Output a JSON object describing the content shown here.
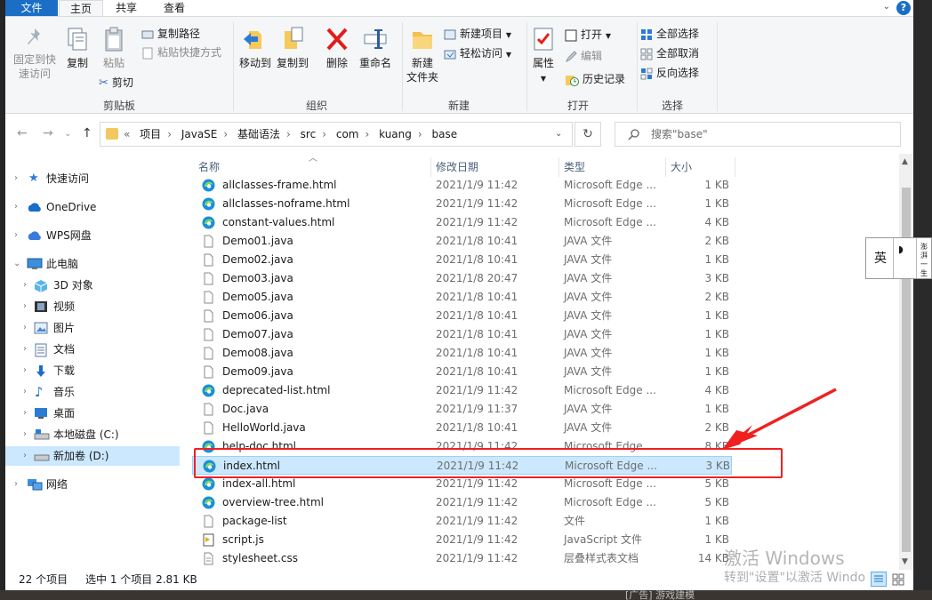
{
  "tabs": [
    {
      "label": "文件"
    },
    {
      "label": "主页"
    },
    {
      "label": "共享"
    },
    {
      "label": "查看"
    }
  ],
  "ribbon": {
    "clipboard": {
      "group_label": "剪贴板",
      "pin_label_1": "固定到快",
      "pin_label_2": "速访问",
      "copy_label": "复制",
      "paste_label": "粘贴",
      "copy_path_label": "复制路径",
      "paste_shortcut_label": "粘贴快捷方式",
      "cut_label": "剪切"
    },
    "organize": {
      "group_label": "组织",
      "move_to_label": "移动到",
      "copy_to_label": "复制到",
      "delete_label": "删除",
      "rename_label": "重命名"
    },
    "new": {
      "group_label": "新建",
      "new_folder_label_1": "新建",
      "new_folder_label_2": "文件夹",
      "new_item_label": "新建项目",
      "easy_access_label": "轻松访问"
    },
    "open": {
      "group_label": "打开",
      "properties_label": "属性",
      "open_label": "打开",
      "edit_label": "编辑",
      "history_label": "历史记录"
    },
    "select": {
      "group_label": "选择",
      "select_all_label": "全部选择",
      "select_none_label": "全部取消",
      "invert_label": "反向选择"
    }
  },
  "address": {
    "overflow": "«",
    "crumbs": [
      "项目",
      "JavaSE",
      "基础语法",
      "src",
      "com",
      "kuang",
      "base"
    ],
    "separator": "›"
  },
  "search": {
    "placeholder": "搜索\"base\""
  },
  "navpane": {
    "items": [
      {
        "label": "快速访问",
        "icon": "star-icon"
      },
      {
        "label": "OneDrive",
        "icon": "cloud-icon"
      },
      {
        "label": "WPS网盘",
        "icon": "cloud-icon"
      },
      {
        "label": "此电脑",
        "icon": "computer-icon"
      },
      {
        "label": "3D 对象",
        "icon": "cube-icon"
      },
      {
        "label": "视频",
        "icon": "film-icon"
      },
      {
        "label": "图片",
        "icon": "picture-icon"
      },
      {
        "label": "文档",
        "icon": "document-icon"
      },
      {
        "label": "下载",
        "icon": "download-icon"
      },
      {
        "label": "音乐",
        "icon": "music-icon"
      },
      {
        "label": "桌面",
        "icon": "desktop-icon"
      },
      {
        "label": "本地磁盘 (C:)",
        "icon": "drive-icon"
      },
      {
        "label": "新加卷 (D:)",
        "icon": "drive-icon"
      },
      {
        "label": "网络",
        "icon": "network-icon"
      }
    ]
  },
  "columns": {
    "name": "名称",
    "date": "修改日期",
    "type": "类型",
    "size": "大小"
  },
  "files": [
    {
      "name": "allclasses-frame.html",
      "date": "2021/1/9 11:42",
      "type": "Microsoft Edge ...",
      "size": "1 KB",
      "icon": "edge"
    },
    {
      "name": "allclasses-noframe.html",
      "date": "2021/1/9 11:42",
      "type": "Microsoft Edge ...",
      "size": "1 KB",
      "icon": "edge"
    },
    {
      "name": "constant-values.html",
      "date": "2021/1/9 11:42",
      "type": "Microsoft Edge ...",
      "size": "4 KB",
      "icon": "edge"
    },
    {
      "name": "Demo01.java",
      "date": "2021/1/8 10:41",
      "type": "JAVA 文件",
      "size": "2 KB",
      "icon": "file"
    },
    {
      "name": "Demo02.java",
      "date": "2021/1/8 10:41",
      "type": "JAVA 文件",
      "size": "1 KB",
      "icon": "file"
    },
    {
      "name": "Demo03.java",
      "date": "2021/1/8 20:47",
      "type": "JAVA 文件",
      "size": "3 KB",
      "icon": "file"
    },
    {
      "name": "Demo05.java",
      "date": "2021/1/8 10:41",
      "type": "JAVA 文件",
      "size": "2 KB",
      "icon": "file"
    },
    {
      "name": "Demo06.java",
      "date": "2021/1/8 10:41",
      "type": "JAVA 文件",
      "size": "1 KB",
      "icon": "file"
    },
    {
      "name": "Demo07.java",
      "date": "2021/1/8 10:41",
      "type": "JAVA 文件",
      "size": "1 KB",
      "icon": "file"
    },
    {
      "name": "Demo08.java",
      "date": "2021/1/8 10:41",
      "type": "JAVA 文件",
      "size": "1 KB",
      "icon": "file"
    },
    {
      "name": "Demo09.java",
      "date": "2021/1/8 10:41",
      "type": "JAVA 文件",
      "size": "1 KB",
      "icon": "file"
    },
    {
      "name": "deprecated-list.html",
      "date": "2021/1/9 11:42",
      "type": "Microsoft Edge ...",
      "size": "4 KB",
      "icon": "edge"
    },
    {
      "name": "Doc.java",
      "date": "2021/1/9 11:37",
      "type": "JAVA 文件",
      "size": "1 KB",
      "icon": "file"
    },
    {
      "name": "HelloWorld.java",
      "date": "2021/1/8 10:41",
      "type": "JAVA 文件",
      "size": "2 KB",
      "icon": "file"
    },
    {
      "name": "help-doc.html",
      "date": "2021/1/9 11:42",
      "type": "Microsoft Edge ...",
      "size": "8 KB",
      "icon": "edge"
    },
    {
      "name": "index.html",
      "date": "2021/1/9 11:42",
      "type": "Microsoft Edge ...",
      "size": "3 KB",
      "icon": "edge",
      "selected": true
    },
    {
      "name": "index-all.html",
      "date": "2021/1/9 11:42",
      "type": "Microsoft Edge ...",
      "size": "5 KB",
      "icon": "edge"
    },
    {
      "name": "overview-tree.html",
      "date": "2021/1/9 11:42",
      "type": "Microsoft Edge ...",
      "size": "5 KB",
      "icon": "edge"
    },
    {
      "name": "package-list",
      "date": "2021/1/9 11:42",
      "type": "文件",
      "size": "1 KB",
      "icon": "file"
    },
    {
      "name": "script.js",
      "date": "2021/1/9 11:42",
      "type": "JavaScript 文件",
      "size": "1 KB",
      "icon": "js"
    },
    {
      "name": "stylesheet.css",
      "date": "2021/1/9 11:42",
      "type": "层叠样式表文档",
      "size": "14 KB",
      "icon": "css"
    }
  ],
  "status": {
    "count": "22 个项目",
    "selected": "选中 1 个项目  2.81 KB"
  },
  "watermark": {
    "line1": "激活 Windows",
    "line2": "转到\"设置\"以激活 Windo"
  },
  "ime": {
    "mode": "英",
    "vertical": "澎湃一生"
  },
  "background": {
    "ad_text": "[广告] 游戏建模"
  },
  "colors": {
    "accent": "#1a6ec6",
    "selection": "#cce8ff",
    "annotation": "#f02020"
  }
}
